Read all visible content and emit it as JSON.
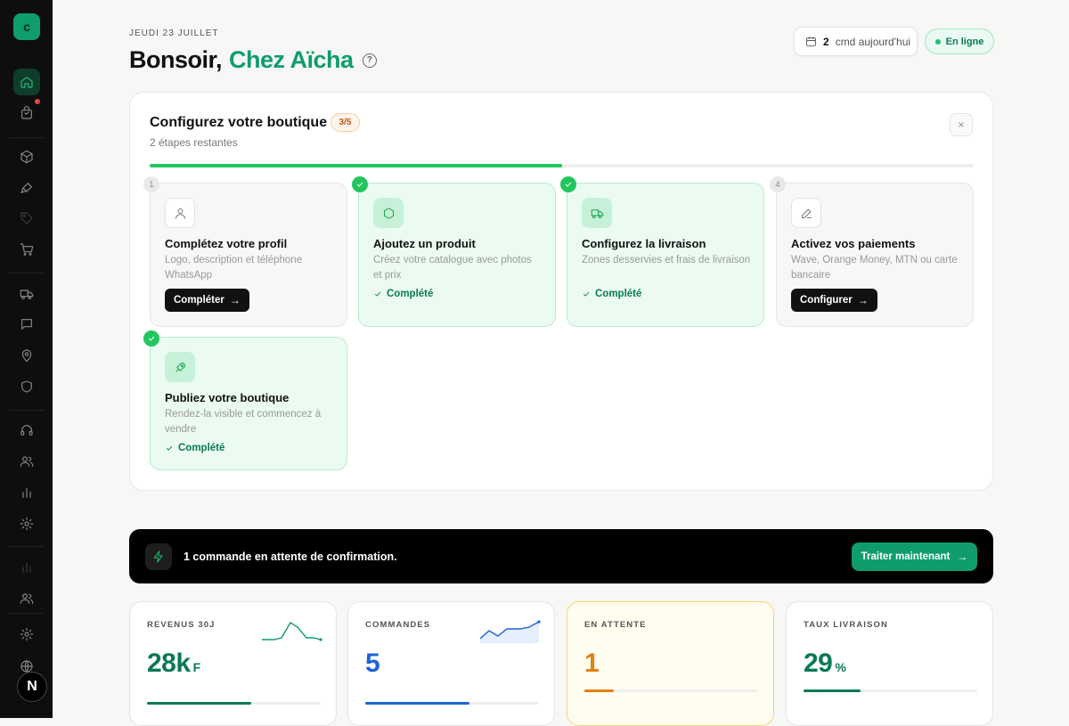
{
  "sidebar": {
    "logo": "c",
    "avatar": "N",
    "items": [
      {
        "icon": "home-icon"
      },
      {
        "icon": "shopping-bag-icon"
      },
      {
        "icon": "box-icon"
      },
      {
        "icon": "brush-icon"
      },
      {
        "icon": "tag-icon"
      },
      {
        "icon": "cart-icon"
      },
      {
        "icon": "truck-icon"
      },
      {
        "icon": "chat-icon"
      },
      {
        "icon": "map-pin-icon"
      },
      {
        "icon": "shield-icon"
      },
      {
        "icon": "headphones-icon"
      },
      {
        "icon": "users-icon"
      },
      {
        "icon": "bar-chart-icon"
      },
      {
        "icon": "settings-icon"
      },
      {
        "icon": "bar-chart-icon"
      },
      {
        "icon": "users-icon"
      },
      {
        "icon": "settings-icon"
      },
      {
        "icon": "globe-icon"
      }
    ]
  },
  "header": {
    "date": "JEUDI 23 JUILLET",
    "greeting": "Bonsoir,",
    "shop_name": "Chez Aïcha",
    "help": "?",
    "orders_count": "2",
    "orders_label": "cmd aujourd'hui",
    "status": "En ligne"
  },
  "setup": {
    "title": "Configurez votre boutique",
    "badge": "3/5",
    "subtitle": "2 étapes restantes",
    "close": "×",
    "progress": 0.5,
    "steps": [
      {
        "num": "1",
        "title": "Complétez votre profil",
        "desc": "Logo, description et téléphone WhatsApp",
        "action": "Compléter"
      },
      {
        "title": "Ajoutez un produit",
        "desc": "Créez votre catalogue avec photos et prix",
        "status": "Complété"
      },
      {
        "title": "Configurez la livraison",
        "desc": "Zones desservies et frais de livraison",
        "status": "Complété"
      },
      {
        "num": "4",
        "title": "Activez vos paiements",
        "desc": "Wave, Orange Money, MTN ou carte bancaire",
        "action": "Configurer"
      },
      {
        "title": "Publiez votre boutique",
        "desc": "Rendez-la visible et commencez à vendre",
        "status": "Complété"
      }
    ]
  },
  "banner": {
    "text": "1 commande en attente de confirmation.",
    "button": "Traiter maintenant"
  },
  "stats": [
    {
      "label": "REVENUS 30J",
      "value": "28k",
      "unit": "F",
      "color": "#0a7a52",
      "progress": 0.6
    },
    {
      "label": "COMMANDES",
      "value": "5",
      "unit": "",
      "color": "#1d63d8",
      "progress": 0.6
    },
    {
      "label": "EN ATTENTE",
      "value": "1",
      "unit": "",
      "color": "#e0820e",
      "progress": 0.17
    },
    {
      "label": "TAUX LIVRAISON",
      "value": "29",
      "unit": "%",
      "color": "#0a7a52",
      "progress": 0.33
    }
  ],
  "colors": {
    "accent": "#0f9d6b",
    "green": "#22c55e",
    "dark": "#0e0e0e"
  }
}
